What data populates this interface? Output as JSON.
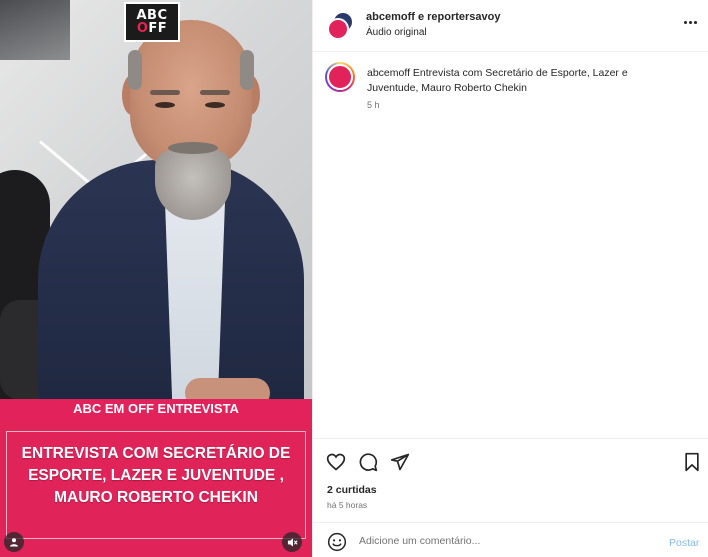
{
  "video": {
    "logo_line1": "ABC",
    "logo_line2_prefix": "",
    "logo_line2": "OFF",
    "strip_label": "ABC EM OFF ENTREVISTA",
    "banner_lines": [
      "ENTREVISTA COM SECRETÁRIO DE",
      "ESPORTE,  LAZER E JUVENTUDE ,",
      "MAURO ROBERTO CHEKIN"
    ]
  },
  "header": {
    "title": "abcemoff e reportersavoy",
    "subtitle": "Áudio original"
  },
  "caption": {
    "username": "abcemoff",
    "text": "Entrevista com Secretário de Esporte, Lazer e Juventude, Mauro Roberto Chekin",
    "time": "5 h"
  },
  "stats": {
    "likes": "2 curtidas",
    "posted_ago": "há 5 horas"
  },
  "comment": {
    "placeholder": "Adicione um comentário...",
    "post_label": "Postar"
  },
  "colors": {
    "banner": "#e0245a",
    "post_button": "#85b8f0"
  },
  "icons": [
    "heart-icon",
    "comment-icon",
    "share-icon",
    "bookmark-icon",
    "emoji-icon",
    "more-icon",
    "user-tag-icon",
    "muted-icon"
  ]
}
